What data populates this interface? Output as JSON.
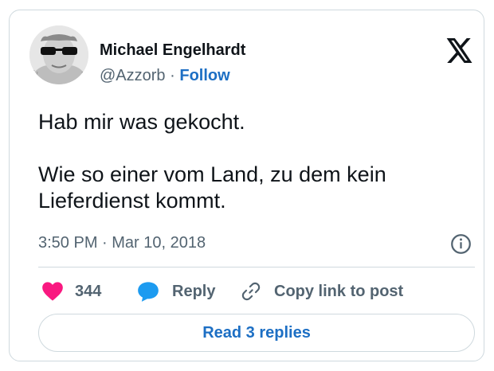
{
  "author": {
    "name": "Michael Engelhardt",
    "handle": "@Azzorb",
    "separator": "·",
    "follow_label": "Follow",
    "avatar_icon": "profile-photo-sunglasses"
  },
  "platform_icon": "x-logo-icon",
  "tweet": {
    "line1": "Hab mir was gekocht.",
    "line2": "Wie so einer vom Land, zu dem kein Lieferdienst kommt."
  },
  "timestamp": "3:50 PM · Mar 10, 2018",
  "actions": {
    "like_count": "344",
    "reply_label": "Reply",
    "copy_label": "Copy link to post"
  },
  "read_replies_label": "Read 3 replies",
  "colors": {
    "like": "#f91880",
    "reply": "#1d9bf0",
    "link": "#1d6fc4",
    "muted": "#536471",
    "border": "#cfd9de"
  }
}
